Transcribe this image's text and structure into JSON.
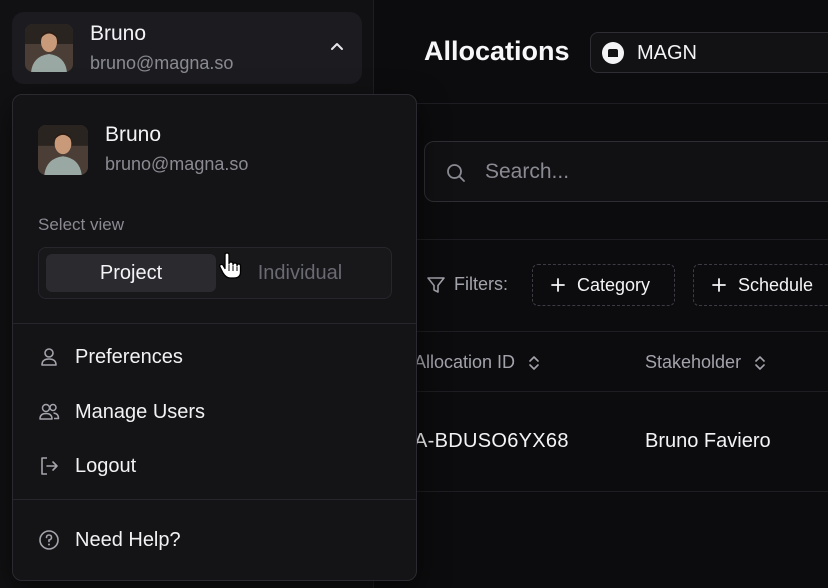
{
  "user": {
    "name": "Bruno",
    "email": "bruno@magna.so"
  },
  "header": {
    "title": "Allocations",
    "project_name": "MAGN"
  },
  "search": {
    "placeholder": "Search..."
  },
  "filters": {
    "label": "Filters:",
    "chips": [
      "Category",
      "Schedule"
    ]
  },
  "table": {
    "columns": [
      "Allocation ID",
      "Stakeholder"
    ],
    "rows": [
      {
        "allocation_id": "A-BDUSO6YX68",
        "stakeholder": "Bruno Faviero"
      }
    ]
  },
  "menu": {
    "select_view_label": "Select view",
    "views": [
      "Project",
      "Individual"
    ],
    "selected_view": "Project",
    "items": [
      {
        "label": "Preferences",
        "icon": "user-icon"
      },
      {
        "label": "Manage Users",
        "icon": "users-icon"
      },
      {
        "label": "Logout",
        "icon": "logout-icon"
      }
    ],
    "help_label": "Need Help?",
    "help_icon": "help-circle-icon"
  },
  "colors": {
    "background": "#0c0c0e",
    "sidebar": "#111113",
    "menu": "#141416",
    "active_toggle": "#2a2a2f",
    "muted_text": "#8a8a92"
  }
}
